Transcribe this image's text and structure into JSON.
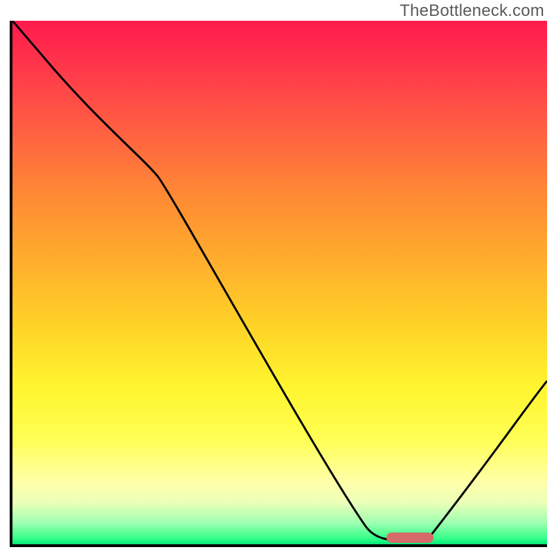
{
  "watermark": "TheBottleneck.com",
  "colors": {
    "gradient_top": "#ff1a4d",
    "gradient_mid": "#ffd227",
    "gradient_bottom": "#00e878",
    "curve": "#000000",
    "axis": "#000000",
    "marker": "#d66a6a",
    "watermark_text": "#5a5a5a"
  },
  "chart_data": {
    "type": "line",
    "title": "",
    "xlabel": "",
    "ylabel": "",
    "xlim": [
      0,
      100
    ],
    "ylim": [
      0,
      100
    ],
    "grid": false,
    "legend": false,
    "x": [
      0,
      8,
      20,
      27,
      57,
      66,
      72,
      78,
      100
    ],
    "values": [
      100,
      91,
      77,
      70,
      16,
      3,
      1,
      2,
      31
    ],
    "marker_range_x": [
      70,
      79
    ],
    "notes": "Values are read off a vertical color gradient where top=100 (red, high bottleneck) and bottom=0 (green, optimal). Curve descends from top-left, kinks near x≈27, reaches a flat minimum around x≈70–79 (highlighted by the red marker pill on the x-axis), then rises again toward the right edge."
  }
}
